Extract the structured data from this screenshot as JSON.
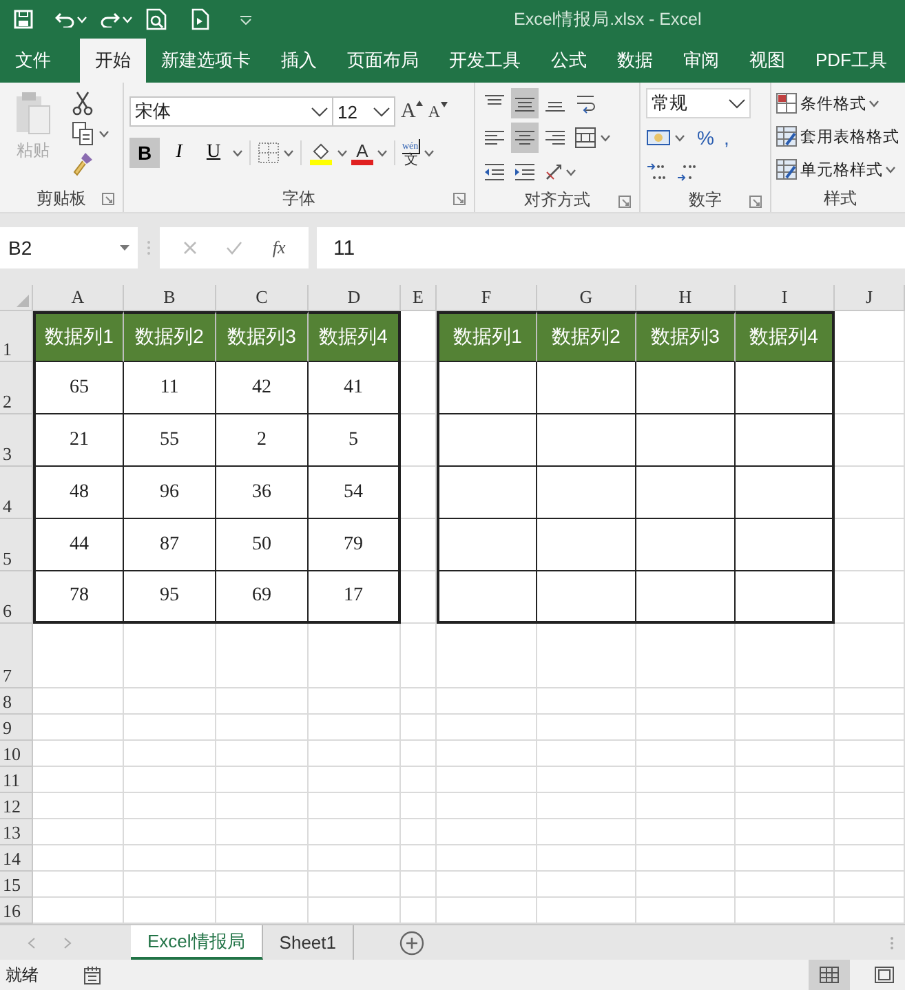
{
  "window": {
    "title": "Excel情报局.xlsx  -  Excel"
  },
  "ribbon_tabs": [
    {
      "label": "文件",
      "selected": false
    },
    {
      "label": "开始",
      "selected": true
    },
    {
      "label": "新建选项卡",
      "selected": false
    },
    {
      "label": "插入",
      "selected": false
    },
    {
      "label": "页面布局",
      "selected": false
    },
    {
      "label": "开发工具",
      "selected": false
    },
    {
      "label": "公式",
      "selected": false
    },
    {
      "label": "数据",
      "selected": false
    },
    {
      "label": "审阅",
      "selected": false
    },
    {
      "label": "视图",
      "selected": false
    },
    {
      "label": "PDF工具",
      "selected": false
    }
  ],
  "clipboard": {
    "group": "剪贴板",
    "paste": {
      "label": "粘贴",
      "disabled": true
    }
  },
  "font": {
    "group": "字体",
    "name": "宋体",
    "size": "12",
    "grow": "A",
    "shrink": "A",
    "color_letter": "A",
    "phonetic": {
      "top": "wén",
      "bottom": "文"
    },
    "buttons": [
      {
        "kind": "bold",
        "label": "B",
        "pressed": true
      },
      {
        "kind": "italic",
        "label": "I",
        "pressed": false
      },
      {
        "kind": "underline",
        "label": "U",
        "pressed": false
      }
    ]
  },
  "alignment": {
    "group": "对齐方式",
    "buttons": [
      {
        "kind": "top",
        "pressed": false
      },
      {
        "kind": "middle",
        "pressed": true
      },
      {
        "kind": "bottom",
        "pressed": false
      },
      {
        "kind": "left",
        "pressed": false
      },
      {
        "kind": "center",
        "pressed": true
      },
      {
        "kind": "right",
        "pressed": false
      }
    ]
  },
  "number": {
    "group": "数字",
    "format": "常规",
    "percent": "%",
    "comma": ","
  },
  "styles": {
    "group": "样式",
    "items": [
      {
        "label": "条件格式",
        "dropdown": true
      },
      {
        "label": "套用表格格式",
        "dropdown": false
      },
      {
        "label": "单元格样式",
        "dropdown": true
      }
    ]
  },
  "formula_bar": {
    "name_box": "B2",
    "function_label": "fx",
    "value": "11"
  },
  "sheet": {
    "columns": [
      "A",
      "B",
      "C",
      "D",
      "E",
      "F",
      "G",
      "H",
      "I",
      "J"
    ],
    "rows": [
      "1",
      "2",
      "3",
      "4",
      "5",
      "6",
      "7",
      "8",
      "9",
      "10",
      "11",
      "12",
      "13",
      "14",
      "15",
      "16"
    ],
    "tables": [
      {
        "headers": [
          "数据列1",
          "数据列2",
          "数据列3",
          "数据列4"
        ],
        "rows": [
          [
            "65",
            "11",
            "42",
            "41"
          ],
          [
            "21",
            "55",
            "2",
            "5"
          ],
          [
            "48",
            "96",
            "36",
            "54"
          ],
          [
            "44",
            "87",
            "50",
            "79"
          ],
          [
            "78",
            "95",
            "69",
            "17"
          ]
        ]
      },
      {
        "headers": [
          "数据列1",
          "数据列2",
          "数据列3",
          "数据列4"
        ],
        "rows": [
          [
            null,
            null,
            null,
            null
          ],
          [
            null,
            null,
            null,
            null
          ],
          [
            null,
            null,
            null,
            null
          ],
          [
            null,
            null,
            null,
            null
          ],
          [
            null,
            null,
            null,
            null
          ]
        ]
      }
    ]
  },
  "sheet_tabs": [
    {
      "label": "Excel情报局",
      "selected": true
    },
    {
      "label": "Sheet1",
      "selected": false
    }
  ],
  "status_bar": {
    "text": "就绪",
    "views": [
      {
        "kind": "normal",
        "selected": true
      },
      {
        "kind": "page_layout",
        "selected": false
      }
    ]
  }
}
